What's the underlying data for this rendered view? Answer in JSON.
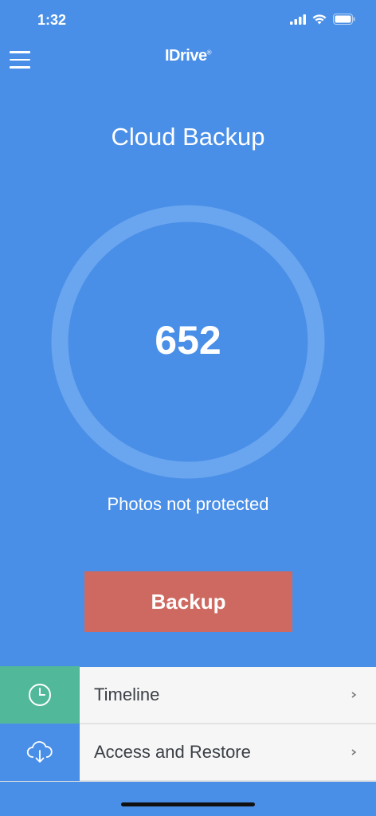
{
  "status_bar": {
    "time": "1:32"
  },
  "header": {
    "logo": "IDrive",
    "logo_mark": "®"
  },
  "main": {
    "title": "Cloud Backup",
    "count": "652",
    "subtitle": "Photos not protected",
    "backup_label": "Backup"
  },
  "list": {
    "items": [
      {
        "label": "Timeline",
        "icon": "clock-icon",
        "icon_bg": "#52b89a"
      },
      {
        "label": "Access and Restore",
        "icon": "cloud-download-icon",
        "icon_bg": "#4a8fe7"
      }
    ]
  },
  "colors": {
    "background": "#4a8fe7",
    "backup_button": "#cd6960",
    "ring": "#6aa6ef"
  }
}
